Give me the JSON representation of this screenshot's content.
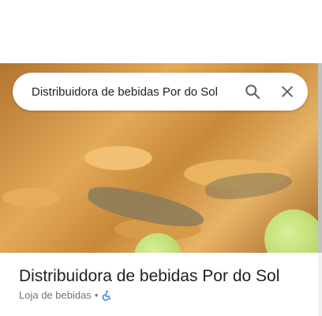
{
  "search": {
    "query": "Distribuidora de bebidas Por do Sol",
    "search_icon": "search-icon",
    "clear_icon": "close-icon"
  },
  "place": {
    "name": "Distribuidora de bebidas Por do Sol",
    "category": "Loja de bebidas",
    "separator": "•",
    "accessibility_icon": "wheelchair-accessible-icon"
  },
  "colors": {
    "accessibility_blue": "#1a73e8",
    "text_primary": "#202124",
    "text_secondary": "#70757a"
  }
}
